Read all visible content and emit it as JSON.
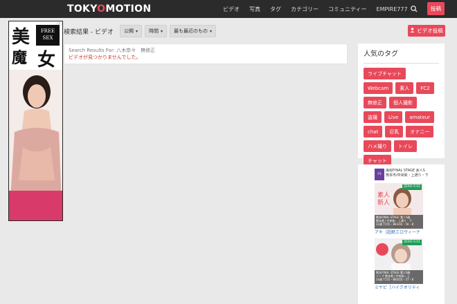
{
  "brand": {
    "name_part1": "TOKY",
    "name_o": "O",
    "name_part2": "MOTION"
  },
  "nav": {
    "items": [
      "ビデオ",
      "写真",
      "タグ",
      "カテゴリー",
      "コミュニティー",
      "EMPIRE777"
    ],
    "search_icon": "search-icon",
    "post_label": "投稿"
  },
  "left_ad": {
    "kanji_1": "美",
    "kanji_2": "魔",
    "kanji_3": "女",
    "free_line1": "FREE",
    "free_line2": "SEX",
    "info": "ⓘ"
  },
  "toolbar": {
    "title": "検索結果 - ビデオ",
    "filters": [
      {
        "label": "公開"
      },
      {
        "label": "時間"
      },
      {
        "label": "最も最近のもの"
      }
    ],
    "upload_label": "ビデオ投稿"
  },
  "results": {
    "query_line": "Search Results For: 八木奈々　無修正",
    "not_found": "ビデオが見つかりませんでした。"
  },
  "tags_panel": {
    "title": "人気のタグ",
    "tags": [
      "ライブチャット",
      "Webcam",
      "素人",
      "FC2",
      "無修正",
      "個人撮影",
      "盗撮",
      "Live",
      "amateur",
      "chat",
      "巨乳",
      "オナニー",
      "ハメ撮り",
      "トイレ",
      "チャット"
    ]
  },
  "right_ad": {
    "items": [
      {
        "head": "風俗FINAL STAGE 素人S",
        "head2": "熊本市/中央街・上通り・下",
        "zero": "ZERO 0.01",
        "strip1": "熊本FINAL STAGE 素人S級",
        "strip2": "熊本県 / 中央街・上通り・下",
        "strip3": "22歳 T155・B83(D)・56・8",
        "caption": "アキ［超絶エロヴィーナ"
      },
      {
        "zero": "ZERO 0.01",
        "strip1": "熊本FINAL STAGE 素人S級",
        "strip2": "ソープ 熊本県 / 中央街・上",
        "strip3": "24歳 T155・B83(D)・57・8",
        "caption": "ミヤビ［ハイクオリティ"
      }
    ]
  },
  "colors": {
    "accent": "#e8495a",
    "navbar": "#2b2b2b",
    "background": "#e9e9e9"
  }
}
